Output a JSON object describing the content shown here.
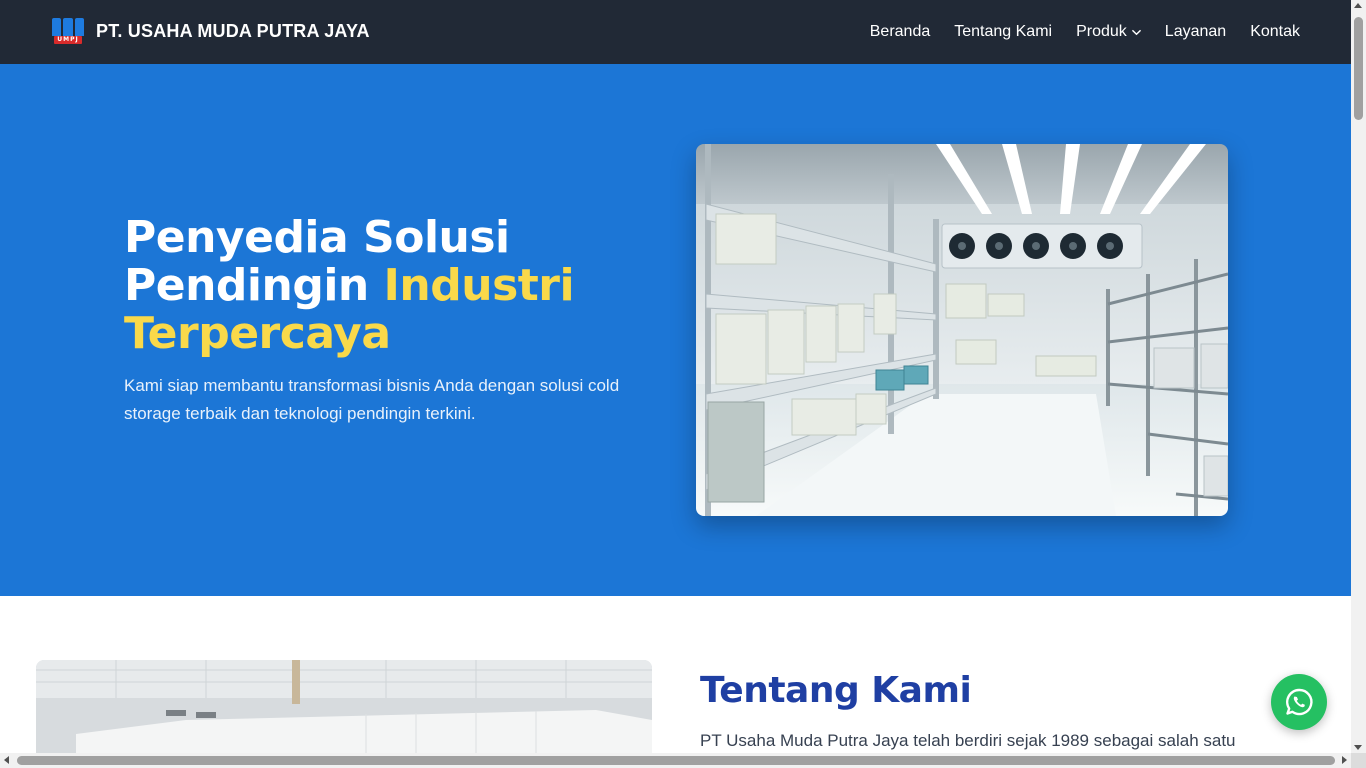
{
  "brand": {
    "name": "PT. USAHA MUDA PUTRA JAYA",
    "logo_text": "UMPJ",
    "logo_icon": "company-logo-icon"
  },
  "nav": {
    "items": [
      {
        "label": "Beranda"
      },
      {
        "label": "Tentang Kami"
      },
      {
        "label": "Produk",
        "dropdown": true
      },
      {
        "label": "Layanan"
      },
      {
        "label": "Kontak"
      }
    ]
  },
  "hero": {
    "title_line1": "Penyedia Solusi",
    "title_line2_plain": "Pendingin ",
    "title_line2_highlight": "Industri",
    "title_line3_highlight": "Terpercaya",
    "subtitle": "Kami siap membantu transformasi bisnis Anda dengan solusi cold storage terbaik dan teknologi pendingin terkini.",
    "image_alt": "cold-storage-room-photo"
  },
  "about": {
    "title": "Tentang Kami",
    "text": "PT Usaha Muda Putra Jaya telah berdiri sejak 1989 sebagai salah satu",
    "image_alt": "cold-room-panel-photo"
  },
  "floating": {
    "whatsapp_icon": "whatsapp-icon"
  },
  "colors": {
    "navbar_bg": "#212936",
    "hero_bg": "#1c76d6",
    "highlight": "#f9d94a",
    "about_title": "#1f3fa3",
    "whatsapp": "#25c062"
  }
}
